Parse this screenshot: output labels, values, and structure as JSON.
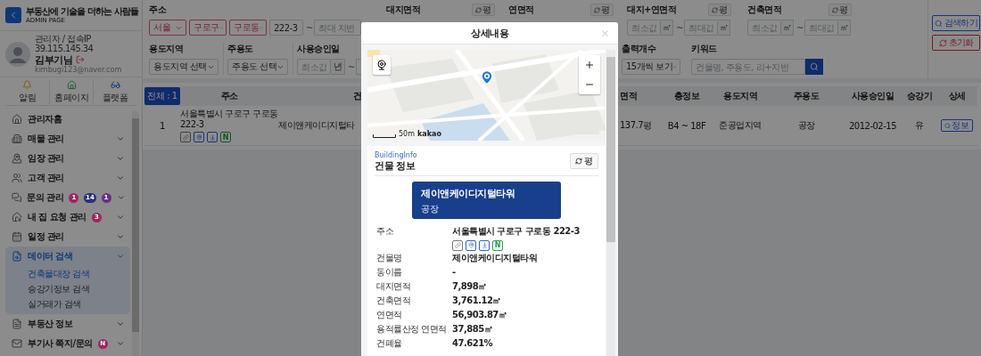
{
  "sidebar": {
    "brand": {
      "title": "부동산에 기술을 더하는 사람들",
      "subtitle": "ADMIN PAGE"
    },
    "profile": {
      "meta": "관리자 / 접속IP 39.115.145.34",
      "name": "김부기님",
      "email": "kimbugi123@naver.com"
    },
    "quick_links": [
      {
        "label": "알림"
      },
      {
        "label": "홈페이지"
      },
      {
        "label": "플랫폼"
      }
    ],
    "menu": [
      {
        "kind": "link",
        "label": "관리자홈"
      },
      {
        "kind": "group",
        "label": "매물 관리",
        "expanded": false
      },
      {
        "kind": "group",
        "label": "임장 관리",
        "expanded": false
      },
      {
        "kind": "group",
        "label": "고객 관리",
        "expanded": false
      },
      {
        "kind": "group",
        "label": "문의 관리",
        "expanded": false,
        "badges": [
          {
            "text": "1",
            "color": "#a3245e"
          },
          {
            "text": "14",
            "color": "#2c3078"
          },
          {
            "text": "1",
            "color": "#66308c"
          }
        ]
      },
      {
        "kind": "group",
        "label": "내 집 요청 관리",
        "expanded": false,
        "badges": [
          {
            "text": "3",
            "color": "#a3245e"
          }
        ]
      },
      {
        "kind": "group",
        "label": "일정 관리",
        "expanded": false
      },
      {
        "kind": "group",
        "label": "데이터 검색",
        "expanded": true,
        "children": [
          {
            "label": "건축물대장 검색",
            "selected": true
          },
          {
            "label": "승강기정보 검색",
            "selected": false
          },
          {
            "label": "실거래가 검색",
            "selected": false
          }
        ]
      },
      {
        "kind": "group",
        "label": "부동산 정보",
        "expanded": false
      },
      {
        "kind": "group",
        "label": "부기사 쪽지/문의",
        "expanded": false,
        "badges": [
          {
            "text": "N",
            "color": "#a3245e"
          }
        ]
      }
    ]
  },
  "filters": {
    "address": {
      "label": "주소",
      "selects": [
        "서울",
        "구로구",
        "구로동"
      ],
      "lot_from": "222-3",
      "separator": "~",
      "lot_to_placeholder": "최대 지번"
    },
    "land_area": {
      "label": "대지면적",
      "unit_toggle": "평"
    },
    "floor_area": {
      "label": "연면적",
      "unit_toggle": "평"
    },
    "land_floor_area": {
      "label": "대지+연면적",
      "unit_toggle": "평",
      "min_placeholder": "최소값",
      "min_unit": "㎡",
      "separator": "~",
      "max_placeholder": "최대값",
      "max_unit": "㎡"
    },
    "building_area": {
      "label": "건축면적",
      "unit_toggle": "평",
      "min_placeholder": "최소값",
      "min_unit": "㎡",
      "separator": "~",
      "max_placeholder": "최대값",
      "max_unit": "㎡"
    },
    "zoning": {
      "label": "용도지역",
      "value": "용도지역 선택"
    },
    "main_use": {
      "label": "주용도",
      "value": "주용도 선택"
    },
    "approval_date": {
      "label": "사용승인일",
      "min_placeholder": "최소값",
      "unit": "년",
      "separator": "~"
    },
    "page_size": {
      "label": "출력개수",
      "value": "15개씩 보기"
    },
    "keyword": {
      "label": "키워드",
      "placeholder": "건물명, 주용도, 리+지번"
    }
  },
  "actions": [
    {
      "kind": "search",
      "label": "검색하기"
    },
    {
      "kind": "reset",
      "label": "초기화"
    }
  ],
  "table": {
    "total": "전체 : 1",
    "columns_left": [
      "주소",
      "건"
    ],
    "columns_right": [
      "면적",
      "층정보",
      "용도지역",
      "주용도",
      "사용승인일",
      "승강기",
      "상세"
    ],
    "rows": [
      {
        "index": "1",
        "address": "서울특별시 구로구 구로동 222-3",
        "links": [
          {
            "kind": "link"
          },
          {
            "kind": "map"
          },
          {
            "kind": "download"
          },
          {
            "kind": "naver",
            "text": "N"
          }
        ],
        "building": "제이앤케이디지털타",
        "area": "137.7평",
        "floors": "B4 ~ 18F",
        "zoning": "준공업지역",
        "main_use": "공장",
        "approval_date": "2012-02-15",
        "elevator": "유",
        "detail": "정보"
      }
    ]
  },
  "modal": {
    "title": "상세내용",
    "map": {
      "scale": "50m",
      "logo": "kakao"
    },
    "info": {
      "eyebrow": "BuildingInfo",
      "title": "건물 정보",
      "unit_toggle": "평",
      "name": "제이앤케이디지털타워",
      "use": "공장",
      "fields": [
        {
          "label": "주소",
          "value": "서울특별시 구로구 구로동 222-3",
          "links": [
            {
              "kind": "link"
            },
            {
              "kind": "map"
            },
            {
              "kind": "download"
            },
            {
              "kind": "naver",
              "text": "N"
            }
          ]
        },
        {
          "label": "건물명",
          "value": "제이앤케이디지털타워"
        },
        {
          "label": "동이름",
          "value": "-"
        },
        {
          "label": "대지면적",
          "value": "7,898㎡"
        },
        {
          "label": "건축면적",
          "value": "3,761.12㎡"
        },
        {
          "label": "연면적",
          "value": "56,903.87㎡"
        },
        {
          "label": "용적률산정 연면적",
          "value": "37,885㎡"
        },
        {
          "label": "건폐율",
          "value": "47.621%"
        }
      ]
    }
  }
}
